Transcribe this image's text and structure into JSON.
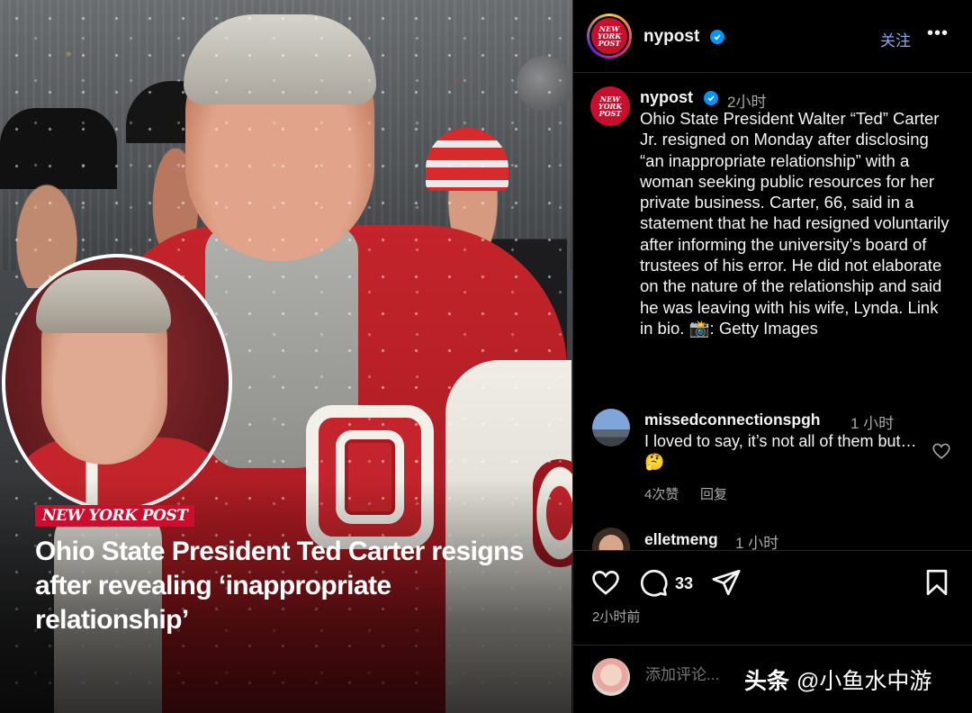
{
  "image": {
    "brand_tag": "NEW YORK POST",
    "headline": "Ohio State President Ted Carter resigns after revealing ‘inappropriate relationship’"
  },
  "post": {
    "avatar_logo_lines": [
      "NEW",
      "YORK",
      "POST"
    ],
    "username": "nypost",
    "follow_label": "关注",
    "more_icon": "more-horizontal-icon"
  },
  "caption": {
    "username": "nypost",
    "time": "2小时",
    "text": "Ohio State President Walter “Ted” Carter Jr. resigned on Monday after disclosing “an inappropriate relationship” with a woman seeking public resources for her private business. Carter, 66, said in a statement that he had resigned voluntarily after informing the university’s board of trustees of his error. He did not elaborate on the nature of the relationship and said he was leaving with his wife, Lynda. Link in bio. 📸: Getty Images"
  },
  "comments": [
    {
      "username": "missedconnectionspgh",
      "time": "1 小时",
      "text": "I loved to say, it’s not all of them but… 🤔",
      "likes": "4次赞",
      "reply": "回复"
    },
    {
      "username": "elletmeng",
      "time": "1 小时"
    }
  ],
  "actions": {
    "comment_count": "33",
    "post_time": "2小时前",
    "icons": [
      "heart-icon",
      "comment-icon",
      "share-icon",
      "bookmark-icon"
    ]
  },
  "composer": {
    "placeholder": "添加评论...",
    "watermark_bold": "头条",
    "watermark_handle": "@小鱼水中游"
  },
  "colors": {
    "brand_red": "#c8102e",
    "verified_blue": "#0095f6",
    "follow_blue": "#85a8ff",
    "muted_text": "#a8a8a8"
  }
}
